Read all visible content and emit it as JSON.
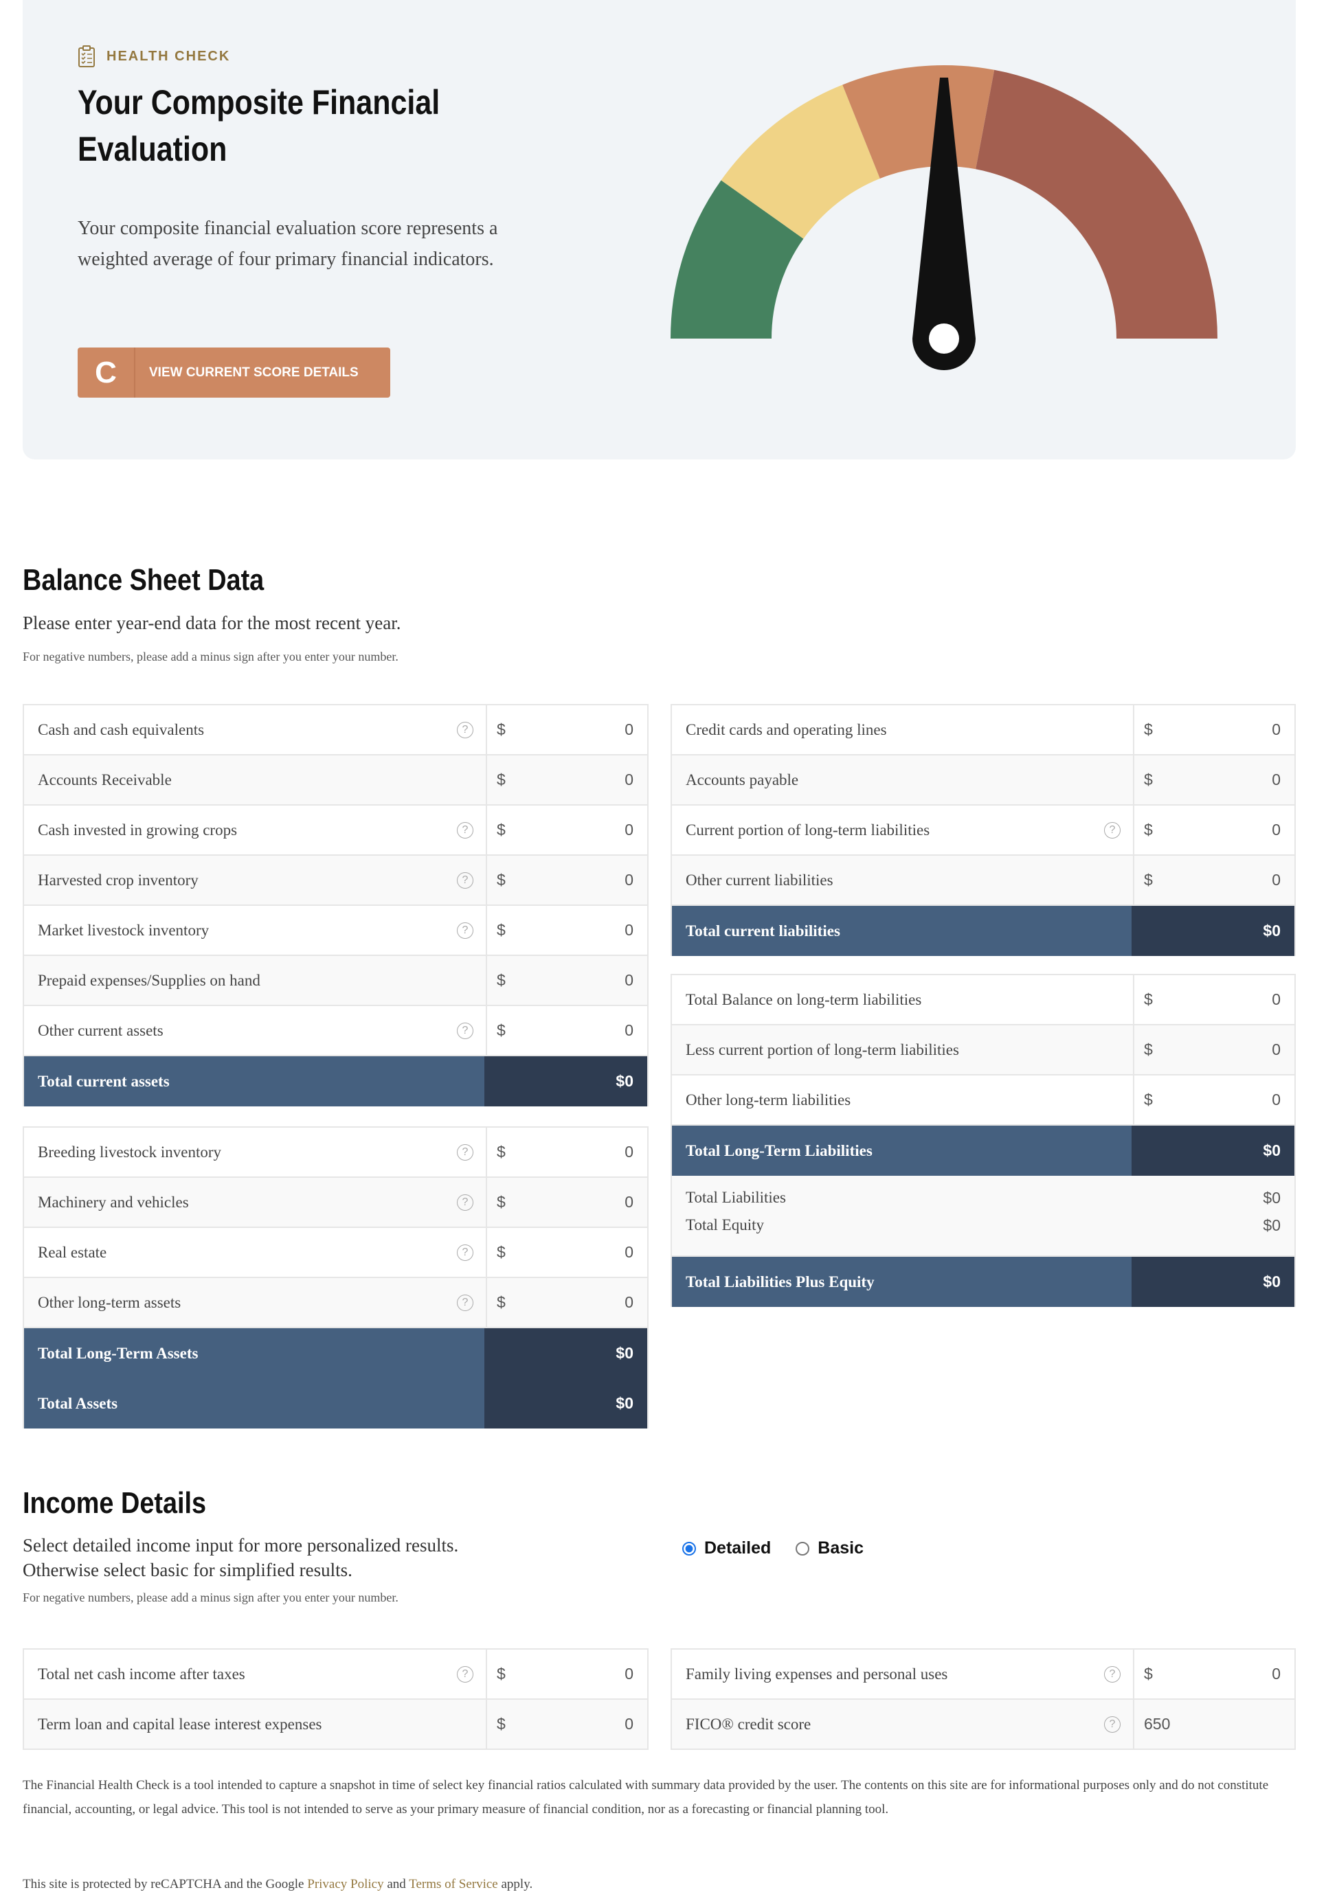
{
  "hero": {
    "eyebrow": "HEALTH CHECK",
    "title": "Your Composite Financial Evaluation",
    "description": "Your composite financial evaluation score represents a weighted average of four primary financial indicators.",
    "grade": "C",
    "cta_label": "VIEW CURRENT SCORE DETAILS",
    "accent": "#cd8862",
    "gauge": {
      "segments": [
        {
          "color": "#45825f"
        },
        {
          "color": "#f0d386"
        },
        {
          "color": "#cd8862"
        },
        {
          "color": "#a35f50"
        }
      ],
      "needle_color": "#111111"
    }
  },
  "balance": {
    "title": "Balance Sheet Data",
    "subtitle": "Please enter year-end data for the most recent year.",
    "note": "For negative numbers, please add a minus sign after you enter your number.",
    "current_assets": [
      {
        "label": "Cash and cash equivalents",
        "help": true,
        "value": "0"
      },
      {
        "label": "Accounts Receivable",
        "help": false,
        "value": "0"
      },
      {
        "label": "Cash invested in growing crops",
        "help": true,
        "value": "0"
      },
      {
        "label": "Harvested crop inventory",
        "help": true,
        "value": "0"
      },
      {
        "label": "Market livestock inventory",
        "help": true,
        "value": "0"
      },
      {
        "label": "Prepaid expenses/Supplies on hand",
        "help": false,
        "value": "0"
      },
      {
        "label": "Other current assets",
        "help": true,
        "value": "0"
      }
    ],
    "total_current_assets": {
      "label": "Total current assets",
      "value": "$0"
    },
    "longterm_assets": [
      {
        "label": "Breeding livestock inventory",
        "help": true,
        "value": "0"
      },
      {
        "label": "Machinery and vehicles",
        "help": true,
        "value": "0"
      },
      {
        "label": "Real estate",
        "help": true,
        "value": "0"
      },
      {
        "label": "Other long-term assets",
        "help": true,
        "value": "0"
      }
    ],
    "total_longterm_assets": {
      "label": "Total Long-Term Assets",
      "value": "$0"
    },
    "total_assets": {
      "label": "Total Assets",
      "value": "$0"
    },
    "current_liabilities": [
      {
        "label": "Credit cards and operating lines",
        "help": false,
        "value": "0"
      },
      {
        "label": "Accounts payable",
        "help": false,
        "value": "0"
      },
      {
        "label": "Current portion of long-term liabilities",
        "help": true,
        "value": "0"
      },
      {
        "label": "Other current liabilities",
        "help": false,
        "value": "0"
      }
    ],
    "total_current_liabilities": {
      "label": "Total current liabilities",
      "value": "$0"
    },
    "longterm_liabilities": [
      {
        "label": "Total Balance on long-term liabilities",
        "help": false,
        "value": "0"
      },
      {
        "label": "Less current portion of long-term liabilities",
        "help": false,
        "value": "0"
      },
      {
        "label": "Other long-term liabilities",
        "help": false,
        "value": "0"
      }
    ],
    "total_longterm_liabilities": {
      "label": "Total Long-Term Liabilities",
      "value": "$0"
    },
    "total_liabilities": {
      "label": "Total Liabilities",
      "value": "$0"
    },
    "total_equity": {
      "label": "Total Equity",
      "value": "$0"
    },
    "total_liab_equity": {
      "label": "Total Liabilities Plus Equity",
      "value": "$0"
    }
  },
  "currency": "$",
  "income": {
    "title": "Income Details",
    "subtitle": "Select detailed income input for more personalized results. Otherwise select basic for simplified results.",
    "note": "For negative numbers, please add a minus sign after you enter your number.",
    "options": [
      {
        "label": "Detailed",
        "selected": true
      },
      {
        "label": "Basic",
        "selected": false
      }
    ],
    "left": [
      {
        "label": "Total net cash income after taxes",
        "help": true,
        "value": "0"
      },
      {
        "label": "Term loan and capital lease interest expenses",
        "help": false,
        "value": "0"
      }
    ],
    "right": [
      {
        "label": "Family living expenses and personal uses",
        "help": true,
        "value": "0"
      },
      {
        "label": "FICO® credit score",
        "help": true,
        "value": "650"
      }
    ]
  },
  "footer": {
    "disclaimer": "The Financial Health Check is a tool intended to capture a snapshot in time of select key financial ratios calculated with summary data provided by the user. The contents on this site are for informational purposes only and do not constitute financial, accounting, or legal advice. This tool is not intended to serve as your primary measure of financial condition, nor as a forecasting or financial planning tool.",
    "recaptcha_pre": "This site is protected by reCAPTCHA and the Google",
    "privacy": "Privacy Policy",
    "and": "and",
    "terms": "Terms of Service",
    "apply": "apply."
  }
}
